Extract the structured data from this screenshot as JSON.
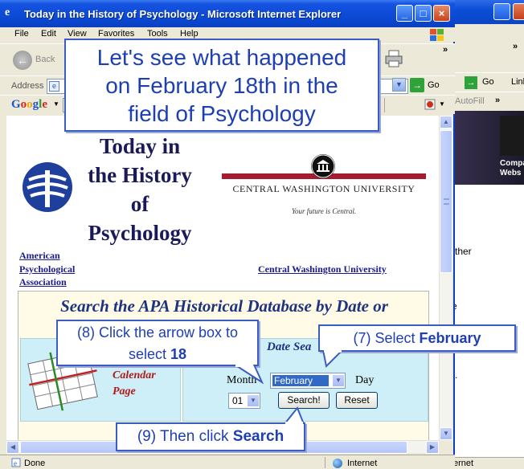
{
  "window": {
    "title": "Today in the History of Psychology - Microsoft Internet Explorer",
    "minimize": "_",
    "maximize": "□",
    "close": "×"
  },
  "menu": [
    "File",
    "Edit",
    "View",
    "Favorites",
    "Tools",
    "Help"
  ],
  "toolbar": {
    "back_label": "Back",
    "more": "»"
  },
  "address": {
    "label": "Address",
    "go_label": "Go"
  },
  "google_bar": {
    "logo": "Google",
    "partial_text": "ed",
    "more": "»"
  },
  "background_window": {
    "go_label": "Go",
    "links_label": "Links",
    "autofill_label": "AutoFill",
    "more": "»",
    "banner_text": "Compa Webs",
    "text_fragments": [
      "ther",
      "e",
      "s."
    ],
    "status_text": "ernet"
  },
  "page": {
    "title_lines": [
      "Today in",
      "the History",
      "of",
      "Psychology"
    ],
    "cwu_name": "CENTRAL WASHINGTON UNIVERSITY",
    "cwu_tagline": "Your future is Central.",
    "apa_link_lines": [
      "American",
      "Psychological",
      "Association"
    ],
    "cwu_link": "Central Washington University",
    "search_heading": "Search the APA Historical Database by Date or",
    "search_heading_tail": "f",
    "date_search_label": "Date Sea",
    "calendar_page_lines": [
      "Calendar",
      "Page"
    ],
    "month_label": "Month",
    "day_label": "Day",
    "month_value": "February",
    "day_value": "01",
    "search_button": "Search!",
    "reset_button": "Reset"
  },
  "status": {
    "text": "Done",
    "zone": "Internet"
  },
  "callouts": {
    "intro_lines": [
      "Let's see what happened",
      "on February 18th in the",
      "field of Psychology"
    ],
    "step8_prefix": "(8) Click the arrow box to",
    "step8_middle": "select ",
    "step8_bold": "18",
    "step7_prefix": "(7) Select ",
    "step7_bold": "February",
    "step9_prefix": "(9) Then click ",
    "step9_bold": "Search"
  },
  "colors": {
    "titlebar": "#0a48d2",
    "callout_text": "#1e3fb4",
    "heading_navy": "#1e3380",
    "calendar_red": "#b01a1a",
    "panel_cyan": "#cfeff8",
    "cwu_red": "#a51c30"
  }
}
